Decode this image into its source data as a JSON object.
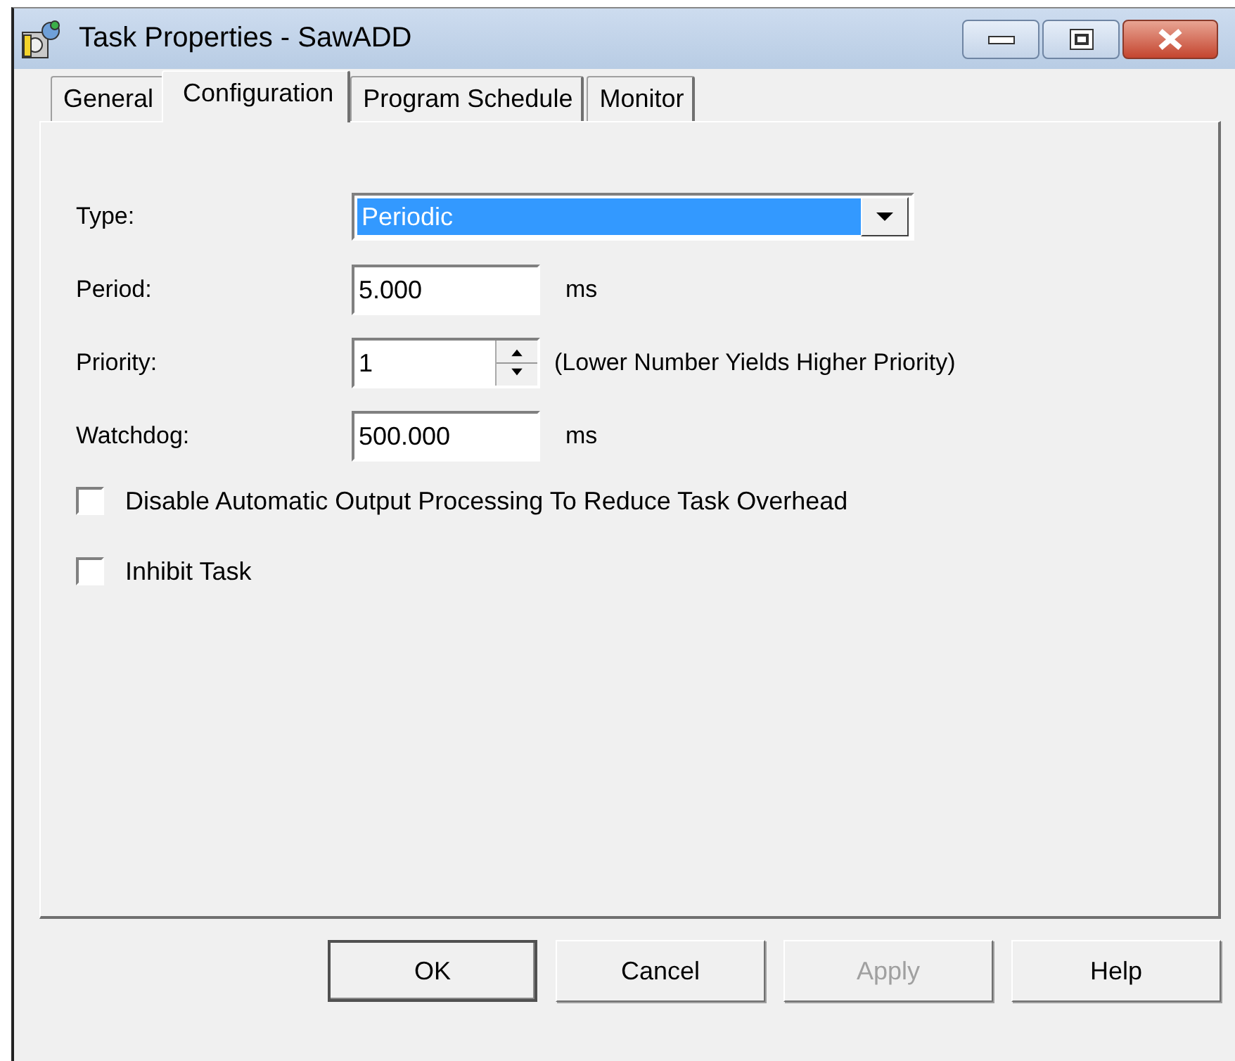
{
  "window": {
    "title": "Task Properties - SawADD"
  },
  "tabs": [
    {
      "label": "General",
      "selected": false
    },
    {
      "label": "Configuration",
      "selected": true
    },
    {
      "label": "Program Schedule",
      "selected": false
    },
    {
      "label": "Monitor",
      "selected": false
    }
  ],
  "fields": [
    {
      "kind": "combo",
      "label": "Type:",
      "value": "Periodic"
    },
    {
      "kind": "text",
      "label": "Period:",
      "value": "5.000",
      "unit": "ms"
    },
    {
      "kind": "spin",
      "label": "Priority:",
      "value": "1",
      "note": "(Lower Number Yields Higher Priority)"
    },
    {
      "kind": "text",
      "label": "Watchdog:",
      "value": "500.000",
      "unit": "ms"
    }
  ],
  "checkboxes": [
    {
      "label": "Disable Automatic Output Processing To Reduce Task Overhead",
      "checked": false
    },
    {
      "label": "Inhibit Task",
      "checked": false
    }
  ],
  "buttons": [
    {
      "label": "OK",
      "default": true,
      "disabled": false
    },
    {
      "label": "Cancel",
      "default": false,
      "disabled": false
    },
    {
      "label": "Apply",
      "default": false,
      "disabled": true
    },
    {
      "label": "Help",
      "default": false,
      "disabled": false
    }
  ]
}
